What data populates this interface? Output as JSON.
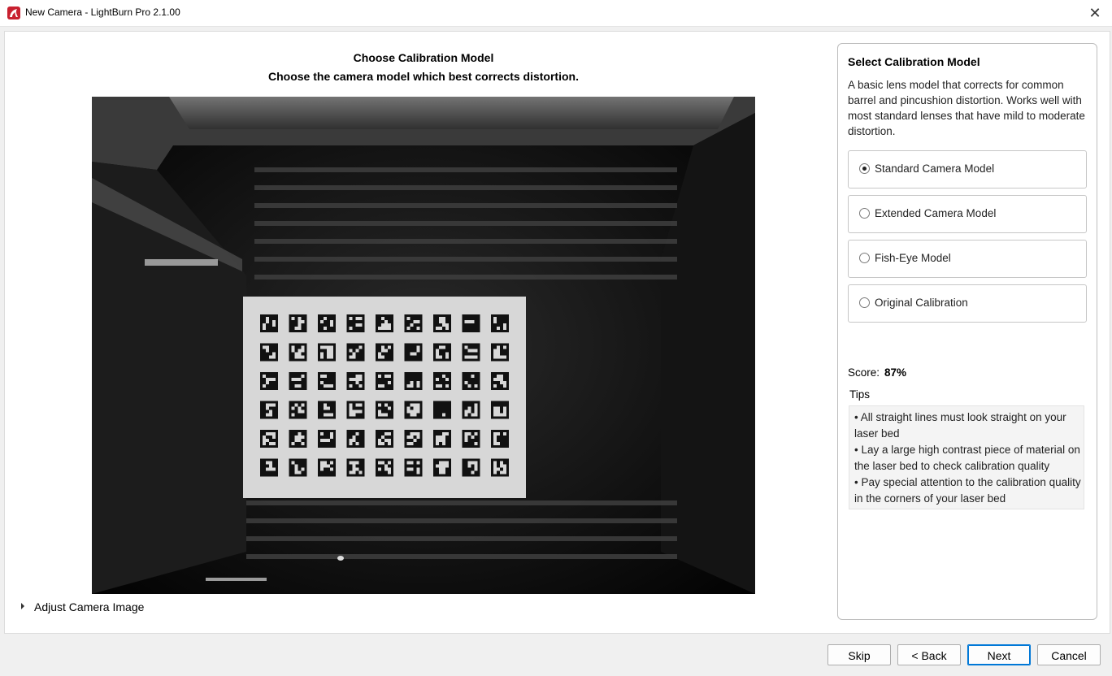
{
  "window": {
    "title": "New Camera - LightBurn Pro 2.1.00"
  },
  "main": {
    "heading": "Choose Calibration Model",
    "subheading": "Choose the camera model which best corrects distortion.",
    "adjust_label": "Adjust Camera Image"
  },
  "panel": {
    "title": "Select Calibration Model",
    "description": "A basic lens model that corrects for common barrel and pincushion distortion. Works well with most standard lenses that have mild to moderate distortion.",
    "options": [
      {
        "label": "Standard Camera Model",
        "selected": true
      },
      {
        "label": "Extended Camera Model",
        "selected": false
      },
      {
        "label": "Fish-Eye Model",
        "selected": false
      },
      {
        "label": "Original Calibration",
        "selected": false
      }
    ],
    "score_label": "Score:",
    "score_value": "87%",
    "tips_label": "Tips",
    "tips": [
      "• All straight lines must look straight on your laser bed",
      "• Lay a large high contrast piece of material on the laser bed to check calibration quality",
      "• Pay special attention to the calibration quality in the corners of your laser bed"
    ]
  },
  "footer": {
    "skip": "Skip",
    "back": "< Back",
    "next": "Next",
    "cancel": "Cancel"
  },
  "colors": {
    "accent": "#0078d7",
    "app_icon": "#c8202f"
  },
  "icons": {
    "app": "lightburn-logo-icon",
    "close": "close-icon",
    "expander": "triangle-right-icon"
  }
}
